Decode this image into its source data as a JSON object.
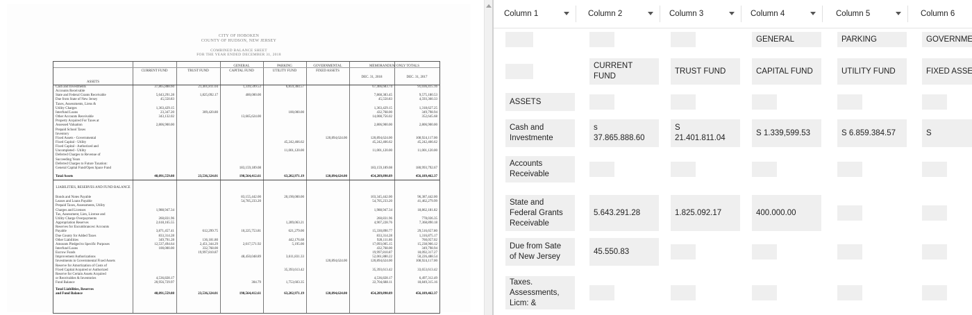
{
  "document": {
    "header": [
      "CITY OF HOBOKEN",
      "COUNTY OF HUDSON, NEW JERSEY",
      "COMBINED BALANCE SHEET",
      "FOR THE YEAR ENDED DECEMBER 31, 2018"
    ],
    "col_heads": {
      "current": "CURRENT FUND",
      "trust": "TRUST FUND",
      "general": "GENERAL",
      "capital": "CAPITAL FUND",
      "parking": "PARKING",
      "utility": "UTILITY FUND",
      "governmental": "GOVERNMENTAL",
      "fixed": "FIXED ASSETS",
      "memo": "MEMORANDUM ONLY TOTALS",
      "dec2018": "DEC. 31, 2018",
      "dec2017": "DEC. 31, 2017"
    },
    "assets_title": "ASSETS",
    "liab_title": "LIABILITIES, RESERVES AND FUND BALANCE",
    "rows": [
      {
        "label": "Cash and Investments",
        "current": "37,865,888.60",
        "trust": "21,401,811.04",
        "capital": "1,339,599.53",
        "utility": "6,859,384.57",
        "fixed": "",
        "memo18": "67,466,683.74",
        "memo17": "91,036,415.16"
      },
      {
        "label": "Accounts Receivable",
        "current": "",
        "trust": "",
        "capital": "",
        "utility": "",
        "fixed": "",
        "memo18": "",
        "memo17": ""
      },
      {
        "label": "State and Federal Grants Receivable",
        "current": "5,643,291.28",
        "trust": "1,825,092.17",
        "capital": "400,000.00",
        "utility": "",
        "fixed": "",
        "memo18": "7,868,383.45",
        "memo17": "9,575,180.53"
      },
      {
        "label": "Due from State of New Jersey",
        "current": "45,550.83",
        "trust": "",
        "capital": "",
        "utility": "",
        "fixed": "",
        "memo18": "45,550.83",
        "memo17": "4,593,360.33"
      },
      {
        "label": "Taxes, Assessments, Liens &",
        "current": "",
        "trust": "",
        "capital": "",
        "utility": "",
        "fixed": "",
        "memo18": "",
        "memo17": ""
      },
      {
        "label": "Utility Charges",
        "current": "1,363,429.15",
        "trust": "",
        "capital": "",
        "utility": "",
        "fixed": "",
        "memo18": "1,363,429.15",
        "memo17": "1,318,627.25"
      },
      {
        "label": "Interfund Loans",
        "current": "23,347.20",
        "trust": "309,420.80",
        "capital": "",
        "utility": "100,000.00",
        "fixed": "",
        "memo18": "432,768.00",
        "memo17": "349,798.94"
      },
      {
        "label": "Other Accounts Receivable",
        "current": "343,132.02",
        "trust": "",
        "capital": "13,665,624.00",
        "utility": "",
        "fixed": "",
        "memo18": "14,008,756.02",
        "memo17": "352,645.68"
      },
      {
        "label": "Property Acquired For Taxes at",
        "current": "",
        "trust": "",
        "capital": "",
        "utility": "",
        "fixed": "",
        "memo18": "",
        "memo17": ""
      },
      {
        "label": "Assessed Valuation",
        "current": "2,806,900.00",
        "trust": "",
        "capital": "",
        "utility": "",
        "fixed": "",
        "memo18": "2,806,900.00",
        "memo17": "2,806,900.00"
      },
      {
        "label": "Prepaid School Taxes",
        "current": "",
        "trust": "",
        "capital": "",
        "utility": "",
        "fixed": "",
        "memo18": "",
        "memo17": ""
      },
      {
        "label": "Inventory",
        "current": "",
        "trust": "",
        "capital": "",
        "utility": "",
        "fixed": "",
        "memo18": "",
        "memo17": ""
      },
      {
        "label": "Fixed Assets - Governmental",
        "current": "",
        "trust": "",
        "capital": "",
        "utility": "",
        "fixed": "120,894,624.00",
        "memo18": "120,894,624.00",
        "memo17": "108,924,117.00"
      },
      {
        "label": "Fixed Capital - Utility",
        "current": "",
        "trust": "",
        "capital": "",
        "utility": "45,242,466.62",
        "fixed": "",
        "memo18": "45,242,466.62",
        "memo17": "45,242,466.62"
      },
      {
        "label": "Fixed Capital - Authorized and",
        "current": "",
        "trust": "",
        "capital": "",
        "utility": "",
        "fixed": "",
        "memo18": "",
        "memo17": ""
      },
      {
        "label": "Uncompleted - Utility",
        "current": "",
        "trust": "",
        "capital": "",
        "utility": "11,001,120.00",
        "fixed": "",
        "memo18": "11,001,120.00",
        "memo17": "11,001,120.00"
      },
      {
        "label": "Deferred Charges to Revenue of",
        "current": "",
        "trust": "",
        "capital": "",
        "utility": "",
        "fixed": "",
        "memo18": "",
        "memo17": ""
      },
      {
        "label": "Succeeding Years",
        "current": "",
        "trust": "",
        "capital": "",
        "utility": "",
        "fixed": "",
        "memo18": "",
        "memo17": ""
      },
      {
        "label": "Deferred Charges to Future Taxation:",
        "current": "",
        "trust": "",
        "capital": "",
        "utility": "",
        "fixed": "",
        "memo18": "",
        "memo17": ""
      },
      {
        "label": "General Capital Fund/Open Space Fund",
        "current": "",
        "trust": "",
        "capital": "183,159,189.08",
        "utility": "",
        "fixed": "",
        "memo18": "183,159,189.08",
        "memo17": "180,993,792.67"
      },
      {
        "label": "Total Assets",
        "bold": true,
        "current": "48,091,559.08",
        "trust": "23,536,324.01",
        "capital": "198,564,412.61",
        "utility": "63,202,971.19",
        "fixed": "120,894,624.00",
        "memo18": "454,289,890.89",
        "memo17": "456,189,462.37"
      }
    ],
    "lrows": [
      {
        "label": "Bonds and Notes Payable",
        "current": "",
        "trust": "",
        "capital": "83,155,442.00",
        "utility": "20,190,000.00",
        "fixed": "",
        "memo18": "103,345,442.00",
        "memo17": "96,387,442.00"
      },
      {
        "label": "Leases and Loans Payable",
        "current": "",
        "trust": "",
        "capital": "54,705,233.20",
        "utility": "",
        "fixed": "",
        "memo18": "54,705,233.20",
        "memo17": "41,462,279.99"
      },
      {
        "label": "Prepaid Taxes, Assessments, Utility",
        "current": "",
        "trust": "",
        "capital": "",
        "utility": "",
        "fixed": "",
        "memo18": "",
        "memo17": ""
      },
      {
        "label": "Charges and Licenses",
        "current": "1,988,947.34",
        "trust": "",
        "capital": "",
        "utility": "",
        "fixed": "",
        "memo18": "1,988,947.34",
        "memo17": "18,862,181.82"
      },
      {
        "label": "Tax, Assessment, Lien, License and",
        "current": "",
        "trust": "",
        "capital": "",
        "utility": "",
        "fixed": "",
        "memo18": "",
        "memo17": ""
      },
      {
        "label": "Utility Charge Overpayments",
        "current": "260,831.96",
        "trust": "",
        "capital": "",
        "utility": "",
        "fixed": "",
        "memo18": "260,831.96",
        "memo17": "778,036.35"
      },
      {
        "label": "Appropriation Reserves",
        "current": "2,618,165.55",
        "trust": "",
        "capital": "",
        "utility": "1,289,063.21",
        "fixed": "",
        "memo18": "4,907,228.76",
        "memo17": "7,368,890.18"
      },
      {
        "label": "Reserves for Encumbrances/ Accounts",
        "current": "",
        "trust": "",
        "capital": "",
        "utility": "",
        "fixed": "",
        "memo18": "",
        "memo17": ""
      },
      {
        "label": "Payable",
        "current": "3,871,457.41",
        "trust": "612,299.75",
        "capital": "10,225,753.81",
        "utility": "621,279.00",
        "fixed": "",
        "memo18": "15,330,890.77",
        "memo17": "29,516,657.80"
      },
      {
        "label": "Due County for Added Taxes",
        "current": "833,314.28",
        "trust": "",
        "capital": "",
        "utility": "",
        "fixed": "",
        "memo18": "833,314.28",
        "memo17": "1,316,875.17"
      },
      {
        "label": "Other Liabilities",
        "current": "349,791.28",
        "trust": "136,181.80",
        "capital": "",
        "utility": "442,176.68",
        "fixed": "",
        "memo18": "928,111.86",
        "memo17": "760,057.02"
      },
      {
        "label": "Amounts Pledged to Specific Purposes",
        "current": "12,537,494.64",
        "trust": "2,451,344.29",
        "capital": "2,017,571.92",
        "utility": "5,195.00",
        "fixed": "",
        "memo18": "17,093,005.15",
        "memo17": "15,238,966.12"
      },
      {
        "label": "Interfund Loans",
        "current": "100,000.00",
        "trust": "332,768.00",
        "capital": "",
        "utility": "",
        "fixed": "",
        "memo18": "432,768.00",
        "memo17": "349,798.94"
      },
      {
        "label": "Escrow Funds",
        "current": "",
        "trust": "19,997,810.87",
        "capital": "",
        "utility": "",
        "fixed": "",
        "memo18": "19,997,810.87",
        "memo17": "18,092,317.27"
      },
      {
        "label": "Improvement Authorizations",
        "current": "",
        "trust": "",
        "capital": "48,450,048.89",
        "utility": "3,611,831.33",
        "fixed": "",
        "memo18": "52,061,880.22",
        "memo17": "50,226,488.54"
      },
      {
        "label": "Investments in Governmental Fixed Assets",
        "current": "",
        "trust": "",
        "capital": "",
        "utility": "",
        "fixed": "120,894,624.00",
        "memo18": "120,894,624.00",
        "memo17": "108,924,117.00"
      },
      {
        "label": "Reserve for Amortization of Costs of",
        "current": "",
        "trust": "",
        "capital": "",
        "utility": "",
        "fixed": "",
        "memo18": "",
        "memo17": ""
      },
      {
        "label": "Fixed Capital Acquired or Authorized",
        "current": "",
        "trust": "",
        "capital": "",
        "utility": "35,393,613.42",
        "fixed": "",
        "memo18": "35,393,613.42",
        "memo17": "33,653,613.42"
      },
      {
        "label": "Reserve for Certain Assets Acquired",
        "current": "",
        "trust": "",
        "capital": "",
        "utility": "",
        "fixed": "",
        "memo18": "",
        "memo17": ""
      },
      {
        "label": "or Receivables & Inventories",
        "current": "4,536,828.17",
        "trust": "",
        "capital": "",
        "utility": "",
        "fixed": "",
        "memo18": "4,536,828.17",
        "memo17": "6,497,312.49"
      },
      {
        "label": "Fund Balance",
        "current": "20,956,729.97",
        "trust": "",
        "capital": "304.79",
        "utility": "1,753,603.35",
        "fixed": "",
        "memo18": "22,704,688.11",
        "memo17": "18,849,315.16"
      },
      {
        "label": "Total Liabilities, Reserves",
        "bold": true,
        "current": "",
        "trust": "",
        "capital": "",
        "utility": "",
        "fixed": "",
        "memo18": "",
        "memo17": ""
      },
      {
        "label": "and Fund Balance",
        "bold": true,
        "current": "48,091,559.08",
        "trust": "23,536,324.01",
        "capital": "198,564,412.61",
        "utility": "63,202,971.19",
        "fixed": "120,894,624.00",
        "memo18": "454,289,890.89",
        "memo17": "456,189,462.37"
      }
    ]
  },
  "spreadsheet": {
    "columns": [
      "Column 1",
      "Column 2",
      "Column 3",
      "Column 4",
      "Column 5",
      "Column 6"
    ],
    "rows": [
      [
        "",
        "",
        "",
        "GENERAL",
        "PARKING",
        "GOVERNMENTAL"
      ],
      [
        "",
        "CURRENT\nFUND",
        "TRUST FUND",
        "CAPITAL FUND",
        "UTILITY FUND",
        "FIXED ASSETS"
      ],
      [
        "ASSETS",
        "",
        "",
        "",
        "",
        ""
      ],
      [
        "Cash and\nInvestmente",
        "s\n37.865.888.60",
        "S\n21.401.811.04",
        "S 1.339,599.53",
        "S 6.859.384.57",
        "S"
      ],
      [
        "Accounts\nReceivable",
        "",
        "",
        "",
        "",
        ""
      ],
      [
        "State and\nFederal Grants\nReceivable",
        "5.643.291.28",
        "1.825.092.17",
        "400.000.00",
        "",
        ""
      ],
      [
        "Due from Sate\nof New Jersey",
        "45.550.83",
        "",
        "",
        "",
        ""
      ],
      [
        "Taxes.\nAssessments,\nLicm: &",
        "",
        "",
        "",
        "",
        ""
      ]
    ]
  }
}
